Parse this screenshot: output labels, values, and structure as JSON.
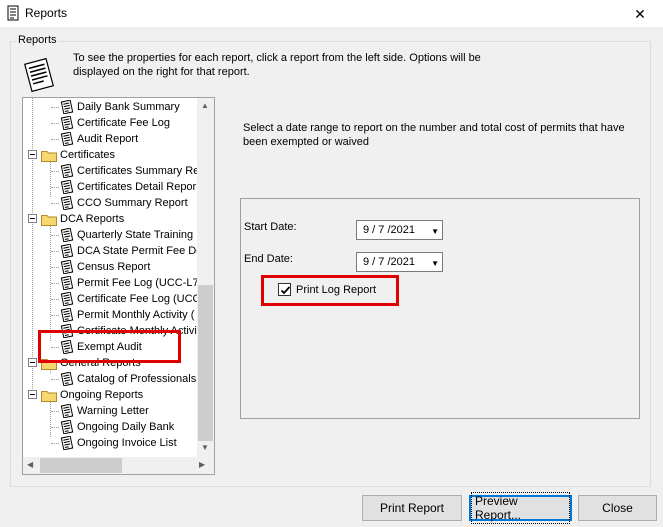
{
  "window": {
    "title": "Reports",
    "close_glyph": "✕"
  },
  "group": {
    "label": "Reports"
  },
  "intro": "To see the properties for each report, click a report from the left side.  Options will be displayed on the right for that report.",
  "tree": {
    "items": [
      {
        "label": "Daily Bank Summary",
        "type": "doc",
        "level": 2
      },
      {
        "label": "Certificate Fee Log",
        "type": "doc",
        "level": 2
      },
      {
        "label": "Audit Report",
        "type": "doc",
        "level": 2
      },
      {
        "label": "Certificates",
        "type": "folder",
        "level": 1
      },
      {
        "label": "Certificates Summary Re",
        "type": "doc",
        "level": 2
      },
      {
        "label": "Certificates Detail Repor",
        "type": "doc",
        "level": 2
      },
      {
        "label": "CCO Summary Report",
        "type": "doc",
        "level": 2
      },
      {
        "label": "DCA Reports",
        "type": "folder",
        "level": 1
      },
      {
        "label": "Quarterly State Training",
        "type": "doc",
        "level": 2
      },
      {
        "label": "DCA State Permit Fee De",
        "type": "doc",
        "level": 2
      },
      {
        "label": "Census Report",
        "type": "doc",
        "level": 2
      },
      {
        "label": "Permit Fee Log (UCC-L70",
        "type": "doc",
        "level": 2
      },
      {
        "label": "Certificate Fee Log (UCC",
        "type": "doc",
        "level": 2
      },
      {
        "label": "Permit Monthly Activity (",
        "type": "doc",
        "level": 2
      },
      {
        "label": "Certificate Monthly Activi",
        "type": "doc",
        "level": 2
      },
      {
        "label": "Exempt Audit",
        "type": "doc",
        "level": 2,
        "selected": true
      },
      {
        "label": "General Reports",
        "type": "folder",
        "level": 1
      },
      {
        "label": "Catalog of Professionals",
        "type": "doc",
        "level": 2
      },
      {
        "label": "Ongoing Reports",
        "type": "folder",
        "level": 1
      },
      {
        "label": "Warning Letter",
        "type": "doc",
        "level": 2
      },
      {
        "label": "Ongoing Daily Bank",
        "type": "doc",
        "level": 2
      },
      {
        "label": "Ongoing Invoice List",
        "type": "doc",
        "level": 2
      }
    ]
  },
  "description": "Select a date range to report on the number and total cost of permits that have been exempted or waived",
  "options": {
    "start_date_label": "Start Date:",
    "start_date_value": "9 / 7 /2021",
    "end_date_label": "End Date:",
    "end_date_value": "9 / 7 /2021",
    "print_log_label": "Print Log Report",
    "print_log_checked": true
  },
  "buttons": {
    "print": "Print Report",
    "preview": "Preview Report...",
    "close": "Close"
  },
  "colors": {
    "highlight": "#e00000",
    "folder": "#f5d76e",
    "focus": "#0078d7"
  }
}
